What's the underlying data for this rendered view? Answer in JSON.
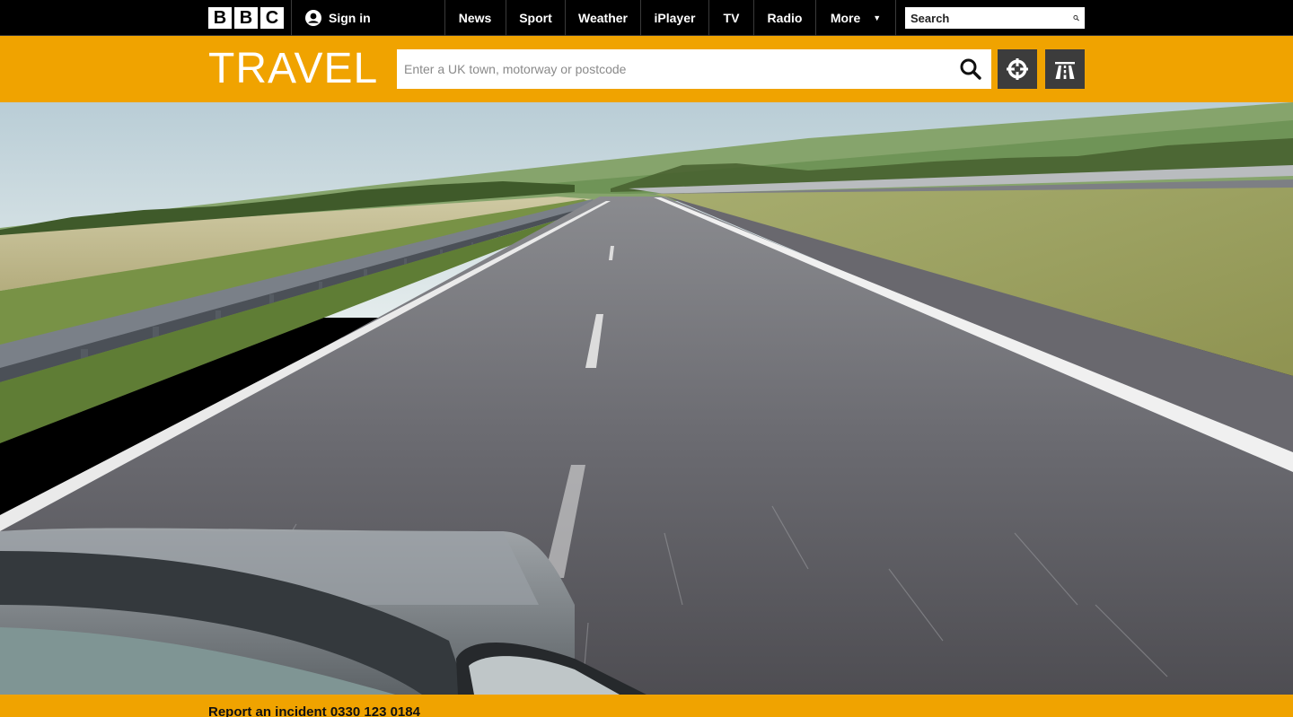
{
  "global_nav": {
    "logo_letters": [
      "B",
      "B",
      "C"
    ],
    "sign_in_label": "Sign in",
    "items": [
      {
        "label": "News"
      },
      {
        "label": "Sport"
      },
      {
        "label": "Weather"
      },
      {
        "label": "iPlayer"
      },
      {
        "label": "TV"
      },
      {
        "label": "Radio"
      },
      {
        "label": "More"
      }
    ],
    "search_placeholder": "Search",
    "icons": {
      "user": "user-icon",
      "search": "search-icon",
      "more": "caret-down-icon"
    }
  },
  "travel": {
    "title": "TRAVEL",
    "search_placeholder": "Enter a UK town, motorway or postcode",
    "buttons": [
      {
        "name": "locate-me",
        "icon": "crosshair-icon"
      },
      {
        "name": "motorways",
        "icon": "motorway-icon"
      }
    ],
    "accent_color": "#f0a300"
  },
  "hero": {
    "scene": "motorway-driving-photo"
  },
  "footer": {
    "report_incident": "Report an incident 0330 123 0184"
  }
}
